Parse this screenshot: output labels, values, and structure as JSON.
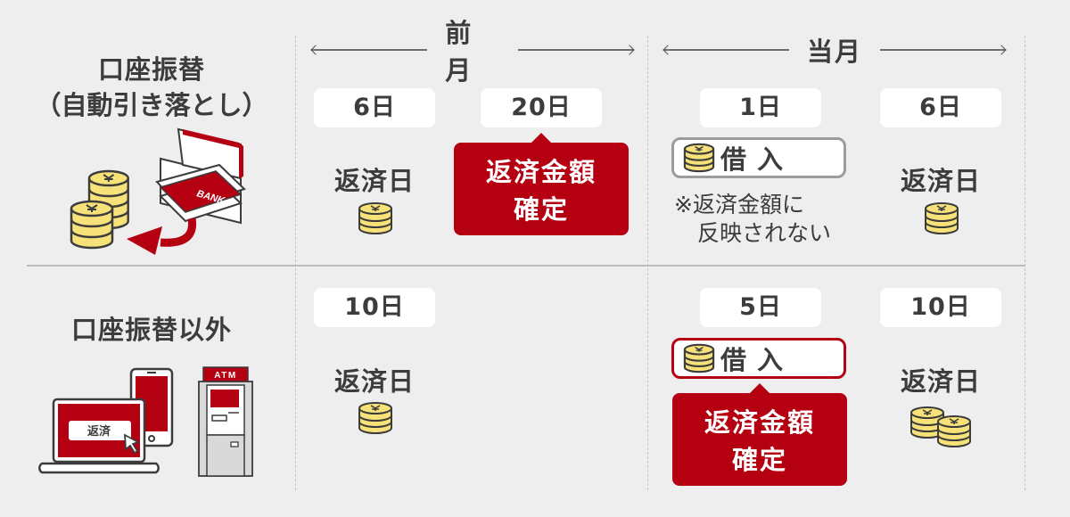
{
  "colors": {
    "background": "#eeeeee",
    "accent_red": "#b50012",
    "coin_yellow": "#f7e27a",
    "text": "#3c3c3c",
    "day_box": "#ffffff"
  },
  "months": {
    "previous": "前月",
    "current": "当月"
  },
  "rows": [
    {
      "title_line1": "口座振替",
      "title_line2": "（自動引き落とし）",
      "illustration": "coins-and-bankbook-icon",
      "illustration_text": "BANK",
      "prev_month": [
        {
          "day": "6日",
          "label": "返済日",
          "coins": 1
        },
        {
          "day": "20日",
          "callout_line1": "返済金額",
          "callout_line2": "確定"
        }
      ],
      "current_month": [
        {
          "day": "1日",
          "borrow": "借入",
          "note_line1": "※返済金額に",
          "note_line2": "反映されない"
        },
        {
          "day": "6日",
          "label": "返済日",
          "coins": 1
        }
      ]
    },
    {
      "title": "口座振替以外",
      "illustration": "laptop-smartphone-atm-icon",
      "laptop_button": "返済",
      "atm_label": "ATM",
      "prev_month": [
        {
          "day": "10日",
          "label": "返済日",
          "coins": 1
        }
      ],
      "current_month": [
        {
          "day": "5日",
          "borrow": "借入",
          "callout_line1": "返済金額",
          "callout_line2": "確定"
        },
        {
          "day": "10日",
          "label": "返済日",
          "coins": 2
        }
      ]
    }
  ]
}
